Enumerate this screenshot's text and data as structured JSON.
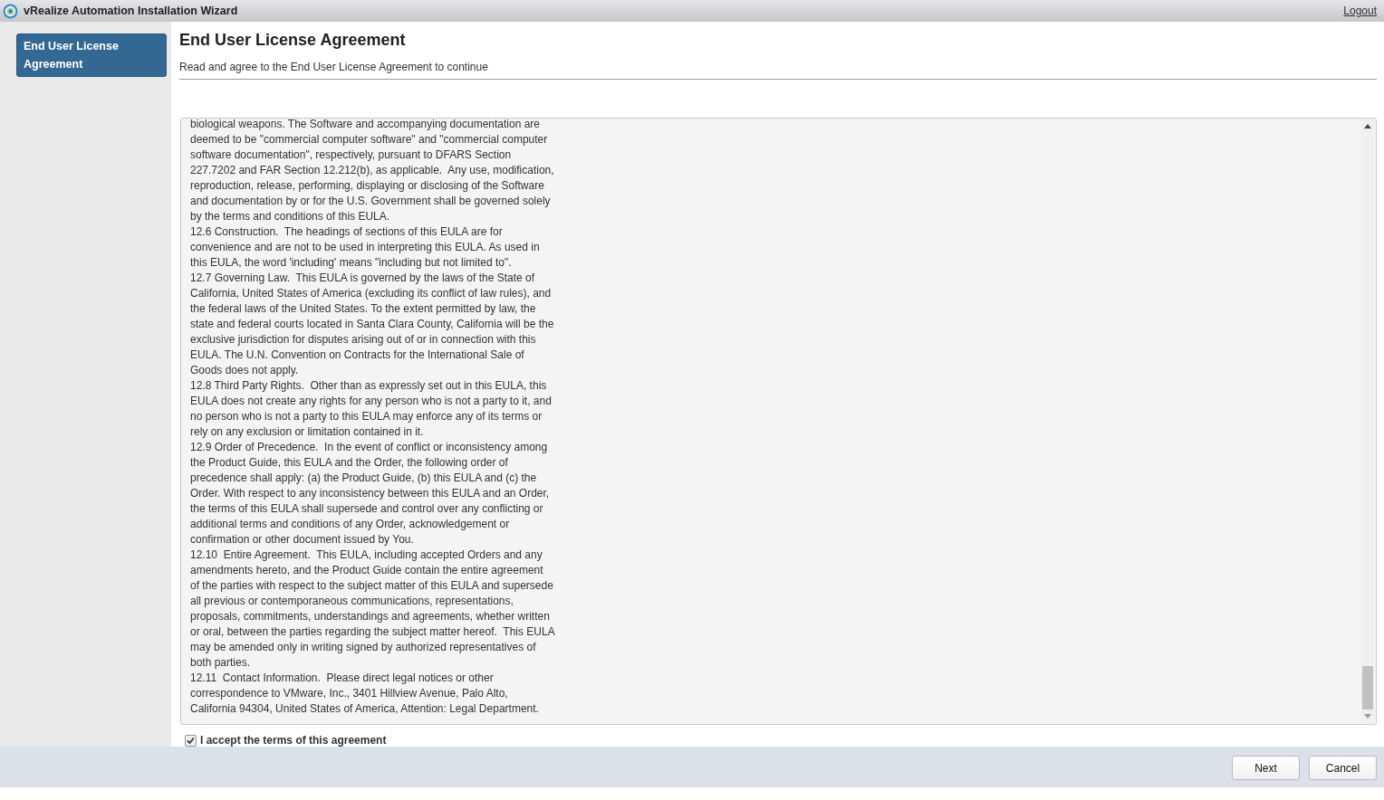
{
  "window": {
    "title": "vRealize Automation Installation Wizard",
    "logout": "Logout"
  },
  "sidebar": {
    "items": [
      {
        "label": "End User License Agreement",
        "selected": true
      }
    ]
  },
  "page": {
    "title": "End User License Agreement",
    "subtitle": "Read and agree to the End User License Agreement to continue"
  },
  "eula": {
    "paragraphs": [
      "biological weapons. The Software and accompanying documentation are deemed to be \"commercial computer software\" and \"commercial computer software documentation\", respectively, pursuant to DFARS Section 227.7202 and FAR Section 12.212(b), as applicable.  Any use, modification, reproduction, release, performing, displaying or disclosing of the Software and documentation by or for the U.S. Government shall be governed solely by the terms and conditions of this EULA.",
      "12.6 Construction.  The headings of sections of this EULA are for convenience and are not to be used in interpreting this EULA. As used in this EULA, the word 'including' means \"including but not limited to\".",
      "12.7 Governing Law.  This EULA is governed by the laws of the State of California, United States of America (excluding its conflict of law rules), and the federal laws of the United States. To the extent permitted by law, the state and federal courts located in Santa Clara County, California will be the exclusive jurisdiction for disputes arising out of or in connection with this EULA. The U.N. Convention on Contracts for the International Sale of Goods does not apply.",
      "12.8 Third Party Rights.  Other than as expressly set out in this EULA, this EULA does not create any rights for any person who is not a party to it, and no person who is not a party to this EULA may enforce any of its terms or rely on any exclusion or limitation contained in it.",
      "12.9 Order of Precedence.  In the event of conflict or inconsistency among the Product Guide, this EULA and the Order, the following order of precedence shall apply: (a) the Product Guide, (b) this EULA and (c) the Order. With respect to any inconsistency between this EULA and an Order, the terms of this EULA shall supersede and control over any conflicting or additional terms and conditions of any Order, acknowledgement or confirmation or other document issued by You.",
      "12.10  Entire Agreement.  This EULA, including accepted Orders and any amendments hereto, and the Product Guide contain the entire agreement of the parties with respect to the subject matter of this EULA and supersede all previous or contemporaneous communications, representations, proposals, commitments, understandings and agreements, whether written or oral, between the parties regarding the subject matter hereof.  This EULA may be amended only in writing signed by authorized representatives of both parties.",
      "12.11  Contact Information.  Please direct legal notices or other correspondence to VMware, Inc., 3401 Hillview Avenue, Palo Alto, California 94304, United States of America, Attention: Legal Department."
    ]
  },
  "accept": {
    "label": "I accept the terms of this agreement",
    "checked": true
  },
  "buttons": [
    {
      "label": "Next"
    },
    {
      "label": "Cancel"
    }
  ]
}
